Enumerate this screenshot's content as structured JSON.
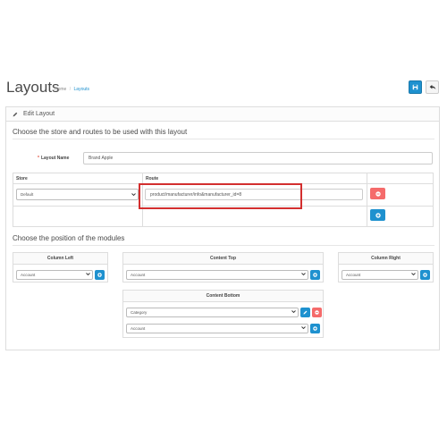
{
  "header": {
    "title": "Layouts",
    "breadcrumb": [
      "Home",
      "Layouts"
    ],
    "save_icon": "save-icon",
    "back_icon": "reply-icon"
  },
  "panel": {
    "heading": "Edit Layout",
    "section_store": "Choose the store and routes to be used with this layout",
    "section_modules": "Choose the position of the modules"
  },
  "form": {
    "layout_name_label": "Layout Name",
    "layout_name_value": "Brand Apple"
  },
  "routes_table": {
    "headers": [
      "Store",
      "Route"
    ],
    "rows": [
      {
        "store": "Default",
        "route": "product/manufacturer/info&manufacturer_id=8"
      }
    ]
  },
  "modules": {
    "column_left": {
      "title": "Column Left",
      "select": "Account"
    },
    "content_top": {
      "title": "Content Top",
      "select": "Account"
    },
    "column_right": {
      "title": "Column Right",
      "select": "Account"
    },
    "content_bottom": {
      "title": "Content Bottom",
      "rows": [
        "Category",
        "Account"
      ]
    }
  },
  "colors": {
    "primary": "#1e91cf",
    "danger": "#f56b6b",
    "highlight": "#d32f2f"
  }
}
